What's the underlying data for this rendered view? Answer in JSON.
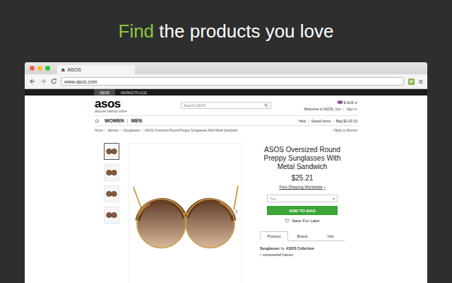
{
  "headline": [
    {
      "text": "Find",
      "accent": true
    },
    {
      "text": "the products you love",
      "accent": false
    }
  ],
  "browser": {
    "tab": {
      "favicon": "a",
      "title": "ASOS"
    },
    "url": "www.asos.com",
    "menu": "≡"
  },
  "site_tabs": [
    {
      "label": "ASOS",
      "selected": true
    },
    {
      "label": "MARKETPLACE",
      "selected": false
    }
  ],
  "header": {
    "logo": "asos",
    "tagline": "discover fashion online",
    "search_placeholder": "Search ASOS",
    "currency": "$ AUD",
    "currency_caret": "▾",
    "welcome": "Welcome to ASOS",
    "account": [
      "Join",
      "Sign In"
    ]
  },
  "nav": {
    "sections": [
      "WOMEN",
      "MEN"
    ],
    "separator": "|",
    "utility": [
      "Help",
      "Saved Items",
      "Bag $0.00 (0)"
    ]
  },
  "breadcrumb": {
    "items": [
      "Home",
      "Women",
      "Sunglasses",
      "ASOS Oversized Round Preppy Sunglasses With Metal Sandwich"
    ],
    "separator": ">",
    "back": "< Back to Women"
  },
  "product": {
    "thumbnails": [
      {
        "selected": true
      },
      {
        "selected": false
      },
      {
        "selected": false
      },
      {
        "selected": false
      }
    ],
    "image_next": "›",
    "title": "ASOS Oversized Round Preppy Sunglasses With Metal Sandwich",
    "price": "$25.21",
    "shipping": "Free Shipping Worldwide",
    "shipping_arrow": "›",
    "size_select": {
      "value": "Tort",
      "caret": "▾"
    },
    "add_button": "ADD TO BAG",
    "save": "Save For Later",
    "tabs": [
      {
        "label": "Product",
        "selected": true
      },
      {
        "label": "Brand",
        "selected": false
      },
      {
        "label": "Info",
        "selected": false
      }
    ],
    "description": {
      "category": "Sunglasses",
      "by": "by",
      "brand": "ASOS Collection",
      "bullet": "•",
      "bullets": [
        "tortoiseshell frames"
      ]
    }
  }
}
